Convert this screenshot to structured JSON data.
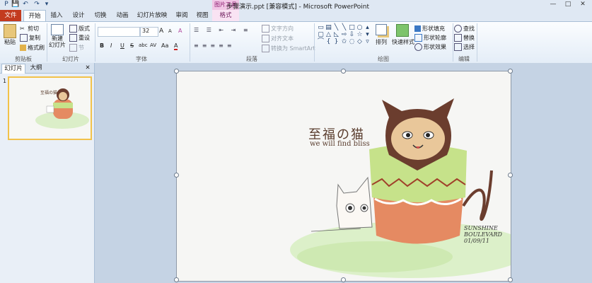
{
  "window": {
    "title": "步骤演示.ppt [兼容模式] - Microsoft PowerPoint",
    "context_tab_header": "图片工具",
    "controls": [
      "—",
      "□",
      "✕"
    ]
  },
  "quick_access": [
    "P",
    "💾",
    "↶",
    "↷",
    "▾"
  ],
  "tabs": [
    "文件",
    "开始",
    "插入",
    "设计",
    "切换",
    "动画",
    "幻灯片放映",
    "审阅",
    "视图",
    "格式"
  ],
  "ribbon": {
    "clipboard": {
      "label": "剪贴板",
      "paste": "粘贴",
      "cut": "剪切",
      "copy": "复制",
      "format_painter": "格式刷"
    },
    "slides": {
      "label": "幻灯片",
      "new_slide": "新建\n幻灯片",
      "layout": "版式",
      "reset": "重设",
      "section": "节"
    },
    "font": {
      "label": "字体",
      "font_name": "",
      "font_size": "32",
      "grow": "A",
      "shrink": "A",
      "clear": "A",
      "bold": "B",
      "italic": "I",
      "underline": "U",
      "strike": "S",
      "shadow": "abc",
      "spacing": "AV",
      "case": "Aa",
      "color": "A"
    },
    "paragraph": {
      "label": "段落",
      "text_direction": "文字方向",
      "align_text": "对齐文本",
      "smartart": "转换为 SmartArt"
    },
    "drawing": {
      "label": "绘图",
      "arrange": "排列",
      "quick_styles": "快速样式",
      "fill": "形状填充",
      "outline": "形状轮廓",
      "effects": "形状效果"
    },
    "editing": {
      "label": "编辑",
      "find": "查找",
      "replace": "替换",
      "select": "选择"
    }
  },
  "left_panel": {
    "tabs": [
      "幻灯片",
      "大纲"
    ],
    "close": "✕",
    "slide_number": "1"
  },
  "slide": {
    "title": "至福の猫",
    "subtitle": "we will find bliss",
    "signature": "SUNSHINE\nBOULEVARD\n01/09/11",
    "thumb_title": "至福の猫"
  },
  "colors": {
    "file_tab": "#c33b1f",
    "picture_tools": "#f1c6e6",
    "ribbon_bg": "#fbfdff",
    "selected_thumb_border": "#f2c24a"
  }
}
